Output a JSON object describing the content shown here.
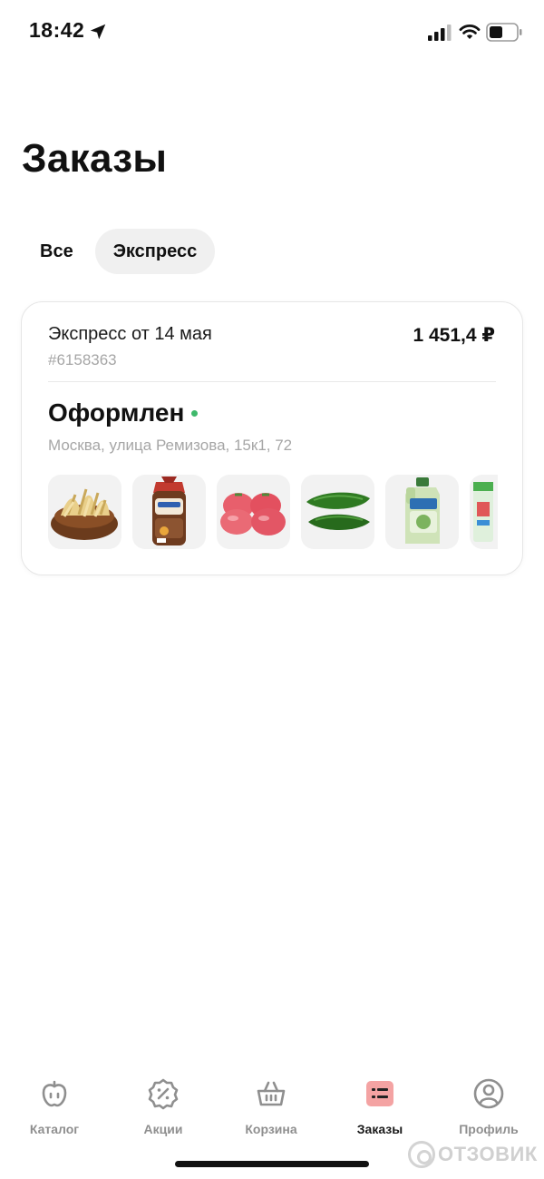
{
  "status_bar": {
    "time": "18:42",
    "icons": [
      "location-arrow-icon",
      "cell-signal-icon",
      "wifi-icon",
      "battery-icon"
    ]
  },
  "page": {
    "title": "Заказы"
  },
  "tabs": [
    {
      "label": "Все",
      "active": false
    },
    {
      "label": "Экспресс",
      "active": true
    }
  ],
  "order": {
    "title": "Экспресс от 14 мая",
    "price": "1 451,4 ₽",
    "number": "#6158363",
    "status": "Оформлен",
    "status_color": "#3fb96b",
    "address": "Москва, улица Ремизова, 15к1, 72",
    "products": [
      "noodles-bowl-image",
      "bread-pack-image",
      "tomatoes-image",
      "cucumbers-image",
      "detergent-bottle-image",
      "product-pack-image"
    ]
  },
  "bottom_nav": [
    {
      "label": "Каталог",
      "icon": "apple-icon",
      "active": false
    },
    {
      "label": "Акции",
      "icon": "percent-badge-icon",
      "active": false
    },
    {
      "label": "Корзина",
      "icon": "basket-icon",
      "active": false
    },
    {
      "label": "Заказы",
      "icon": "orders-list-icon",
      "active": true
    },
    {
      "label": "Профиль",
      "icon": "profile-icon",
      "active": false
    }
  ],
  "watermark": {
    "text": "ОТЗОВИК"
  },
  "colors": {
    "accent": "#f4a3a3",
    "muted": "#a6a6a6",
    "nav_muted": "#8f8f8f"
  }
}
